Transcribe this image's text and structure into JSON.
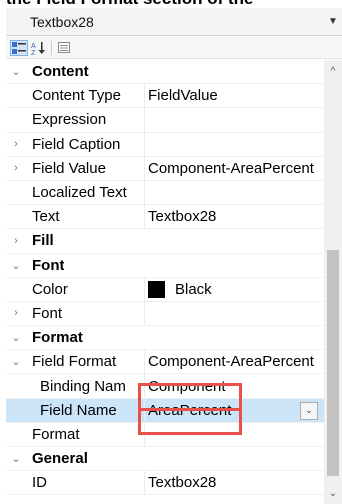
{
  "caption": "the Field Format section of the",
  "object_selector": {
    "value": "Textbox28"
  },
  "toolbar": {
    "icons": [
      "categorized-icon",
      "alphabetical-icon",
      "property-pages-icon"
    ]
  },
  "rows": {
    "content": {
      "label": "Content"
    },
    "content_type": {
      "name": "Content Type",
      "value": "FieldValue"
    },
    "expression": {
      "name": "Expression",
      "value": ""
    },
    "field_caption": {
      "name": "Field Caption",
      "value": ""
    },
    "field_value": {
      "name": "Field Value",
      "value": "Component-AreaPercent"
    },
    "localized_text": {
      "name": "Localized Text",
      "value": ""
    },
    "text": {
      "name": "Text",
      "value": "Textbox28"
    },
    "fill": {
      "label": "Fill"
    },
    "font_cat": {
      "label": "Font"
    },
    "color": {
      "name": "Color",
      "value": "Black",
      "swatch": "#000000"
    },
    "font": {
      "name": "Font",
      "value": ""
    },
    "format_cat": {
      "label": "Format"
    },
    "field_format": {
      "name": "Field Format",
      "value": "Component-AreaPercent"
    },
    "binding_name": {
      "name": "Binding Nam",
      "value": "Component"
    },
    "field_name": {
      "name": "Field Name",
      "value": "AreaPercent"
    },
    "format": {
      "name": "Format",
      "value": ""
    },
    "general": {
      "label": "General"
    },
    "id": {
      "name": "ID",
      "value": "Textbox28"
    }
  },
  "colors": {
    "highlight_box": "#e8504a",
    "selected_row": "#cce4f7"
  }
}
